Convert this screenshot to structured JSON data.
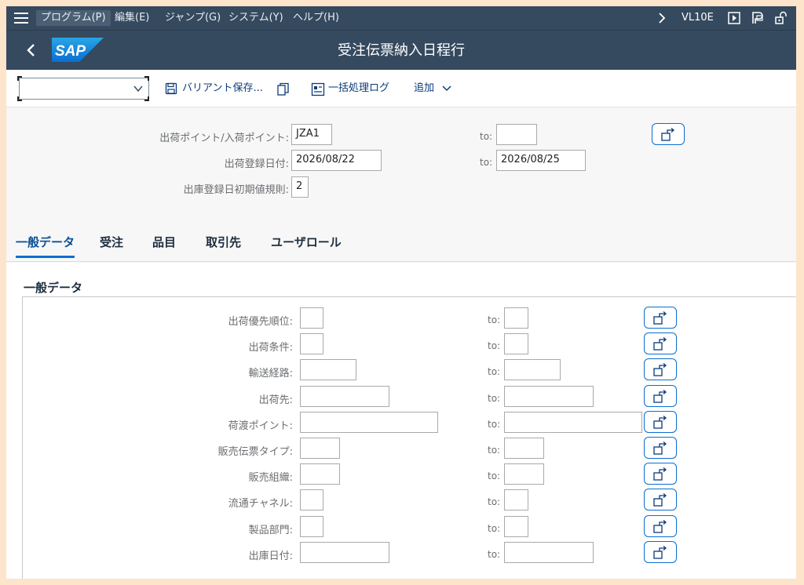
{
  "menubar": {
    "items": [
      "プログラム(P)",
      "編集(E)",
      "ジャンプ(G)",
      "システム(Y)",
      "ヘルプ(H)"
    ],
    "transaction": "VL10E"
  },
  "titlebar": {
    "title": "受注伝票納入日程行",
    "logo_text": "SAP"
  },
  "toolbar": {
    "variant_value": "",
    "save_variant": "バリアント保存...",
    "batch_log": "一括処理ログ",
    "more": "追加"
  },
  "header_fields": [
    {
      "label": "出荷ポイント/入荷ポイント:",
      "from": "JZA1",
      "to_label": "to:",
      "to": ""
    },
    {
      "label": "出荷登録日付:",
      "from": "2026/08/22",
      "to_label": "to:",
      "to": "2026/08/25"
    },
    {
      "label": "出庫登録日初期値規則:",
      "from": "2"
    }
  ],
  "tabs": [
    "一般データ",
    "受注",
    "品目",
    "取引先",
    "ユーザロール"
  ],
  "section": {
    "title": "一般データ",
    "fields": [
      {
        "label": "出荷優先順位:",
        "from": "",
        "to_label": "to:",
        "to": ""
      },
      {
        "label": "出荷条件:",
        "from": "",
        "to_label": "to:",
        "to": ""
      },
      {
        "label": "輸送経路:",
        "from": "",
        "to_label": "to:",
        "to": ""
      },
      {
        "label": "出荷先:",
        "from": "",
        "to_label": "to:",
        "to": ""
      },
      {
        "label": "荷渡ポイント:",
        "from": "",
        "to_label": "to:",
        "to": ""
      },
      {
        "label": "販売伝票タイプ:",
        "from": "",
        "to_label": "to:",
        "to": ""
      },
      {
        "label": "販売組織:",
        "from": "",
        "to_label": "to:",
        "to": ""
      },
      {
        "label": "流通チャネル:",
        "from": "",
        "to_label": "to:",
        "to": ""
      },
      {
        "label": "製品部門:",
        "from": "",
        "to_label": "to:",
        "to": ""
      },
      {
        "label": "出庫日付:",
        "from": "",
        "to_label": "to:",
        "to": ""
      }
    ]
  },
  "colors": {
    "shell": "#354a5f",
    "accent": "#0a6ed1",
    "page": "#f7f7f7",
    "outer": "#fde5cb"
  }
}
